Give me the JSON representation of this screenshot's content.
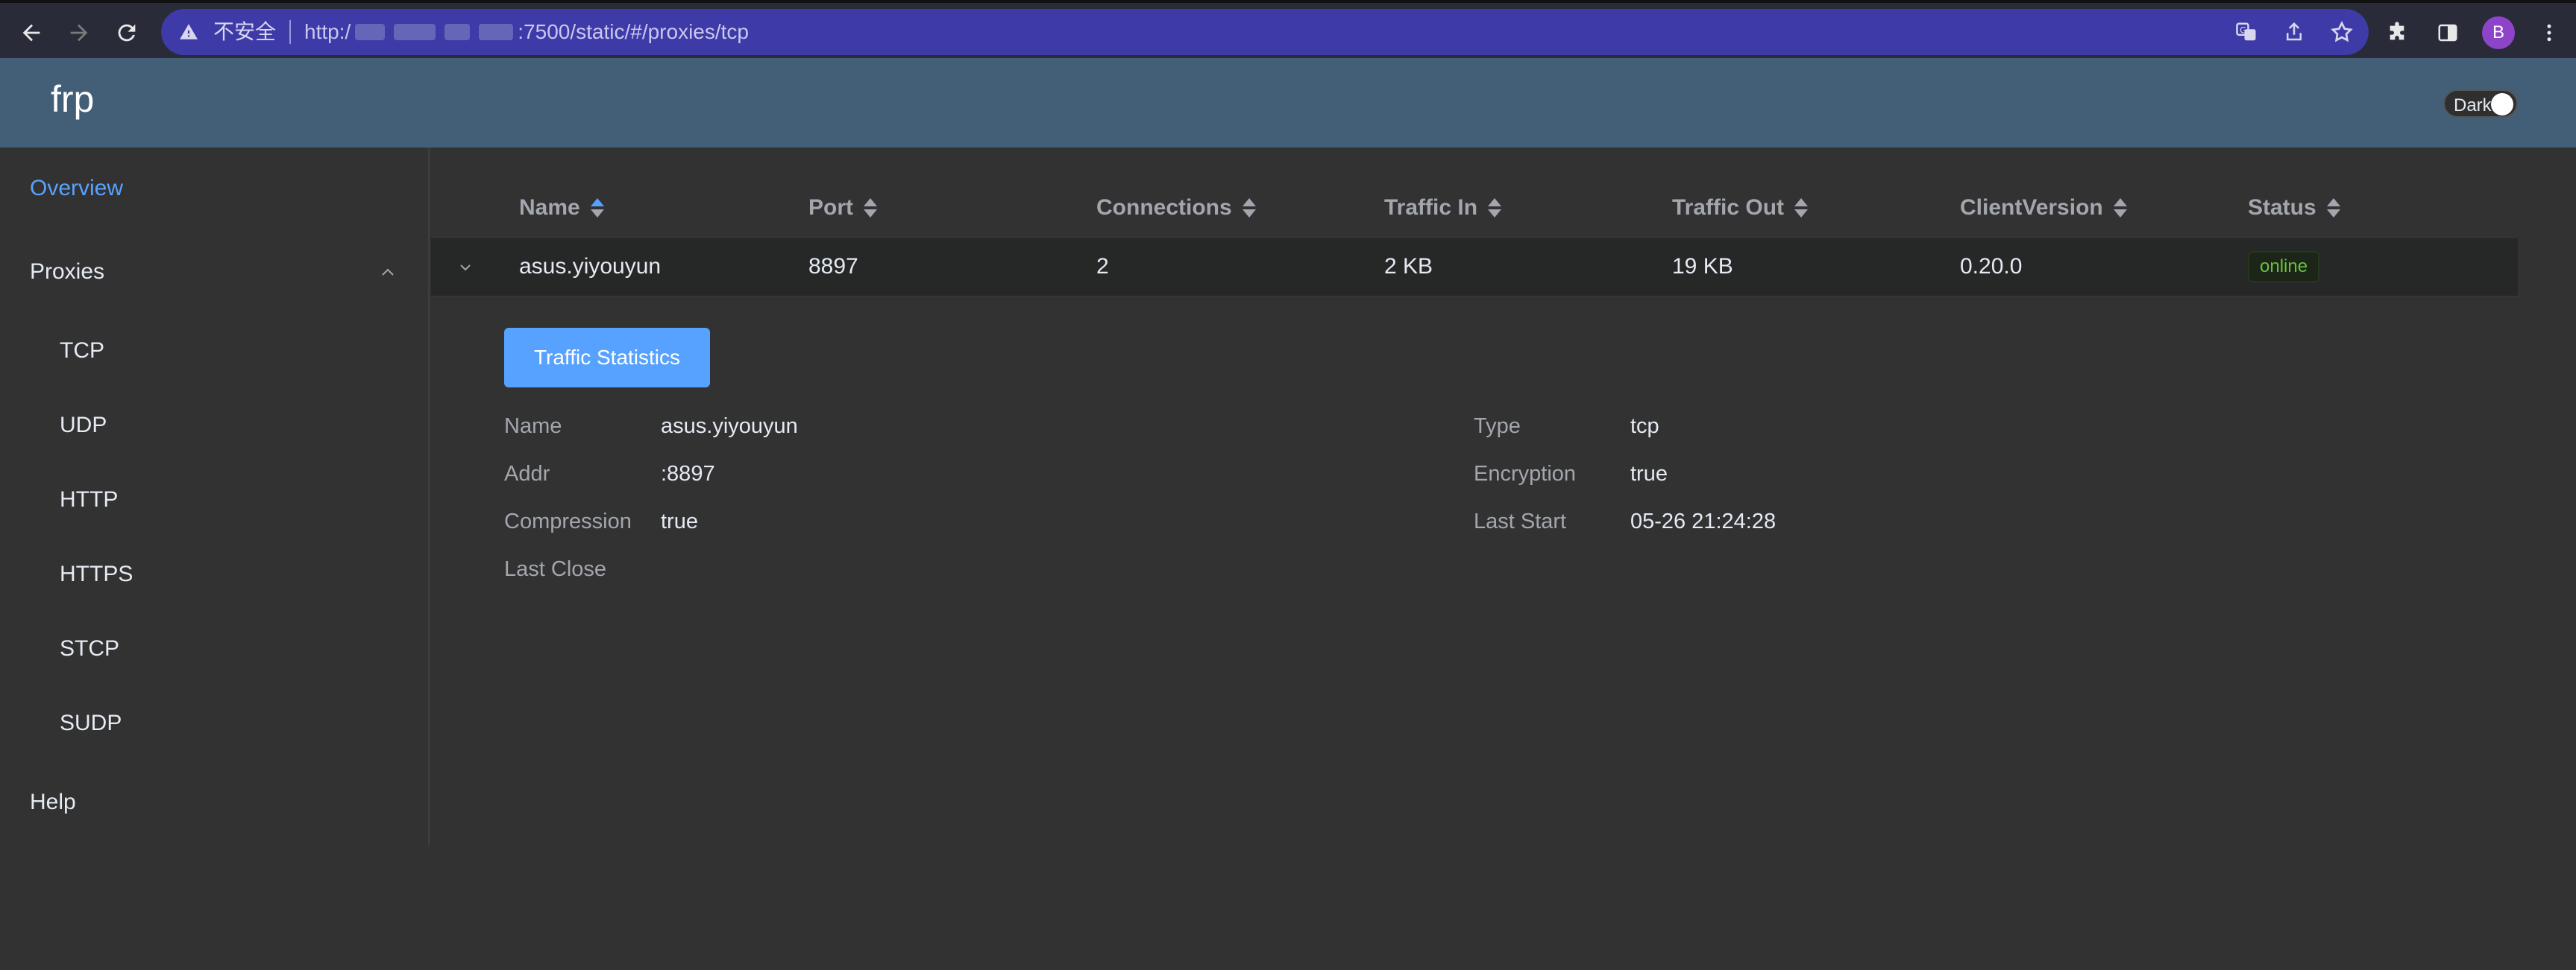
{
  "browser": {
    "security_label": "不安全",
    "url_prefix": "http:/",
    "url_suffix": ":7500/static/#/proxies/tcp",
    "avatar_letter": "B"
  },
  "header": {
    "brand": "frp",
    "dark_toggle_label": "Dark",
    "dark_mode_on": true
  },
  "sidebar": {
    "overview": "Overview",
    "proxies": "Proxies",
    "proxy_types": [
      "TCP",
      "UDP",
      "HTTP",
      "HTTPS",
      "STCP",
      "SUDP"
    ],
    "help": "Help"
  },
  "table": {
    "columns": [
      "Name",
      "Port",
      "Connections",
      "Traffic In",
      "Traffic Out",
      "ClientVersion",
      "Status"
    ],
    "rows": [
      {
        "name": "asus.yiyouyun",
        "port": "8897",
        "connections": "2",
        "traffic_in": "2 KB",
        "traffic_out": "19 KB",
        "client_version": "0.20.0",
        "status": "online"
      }
    ]
  },
  "detail": {
    "button_label": "Traffic Statistics",
    "left": [
      {
        "label": "Name",
        "value": "asus.yiyouyun"
      },
      {
        "label": "Addr",
        "value": ":8897"
      },
      {
        "label": "Compression",
        "value": "true"
      },
      {
        "label": "Last Close",
        "value": ""
      }
    ],
    "right": [
      {
        "label": "Type",
        "value": "tcp"
      },
      {
        "label": "Encryption",
        "value": "true"
      },
      {
        "label": "Last Start",
        "value": "05-26 21:24:28"
      }
    ]
  },
  "colors": {
    "accent": "#58a2ff",
    "header_bg": "#435f78",
    "page_bg": "#323232",
    "online": "#67c23a"
  }
}
